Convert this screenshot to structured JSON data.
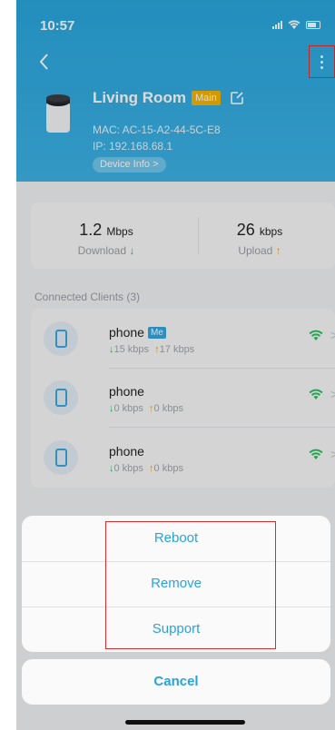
{
  "status": {
    "time": "10:57"
  },
  "device": {
    "name": "Living Room",
    "badge": "Main",
    "mac": "MAC: AC-15-A2-44-5C-E8",
    "ip": "IP: 192.168.68.1",
    "info_button": "Device Info >"
  },
  "speed": {
    "download_value": "1.2",
    "download_unit": "Mbps",
    "download_label": "Download",
    "upload_value": "26",
    "upload_unit": "kbps",
    "upload_label": "Upload"
  },
  "clients": {
    "title": "Connected Clients (3)",
    "items": [
      {
        "name": "phone",
        "badge": "Me",
        "down": "15 kbps",
        "up": "17 kbps"
      },
      {
        "name": "phone",
        "down": "0 kbps",
        "up": "0 kbps"
      },
      {
        "name": "phone",
        "down": "0 kbps",
        "up": "0 kbps"
      }
    ]
  },
  "action_sheet": {
    "reboot": "Reboot",
    "remove": "Remove",
    "support": "Support",
    "cancel": "Cancel"
  },
  "colors": {
    "accent": "#2aa3dc",
    "header": "#29a6dd",
    "badge_main": "#f5b400",
    "wifi": "#2bbf5c"
  }
}
